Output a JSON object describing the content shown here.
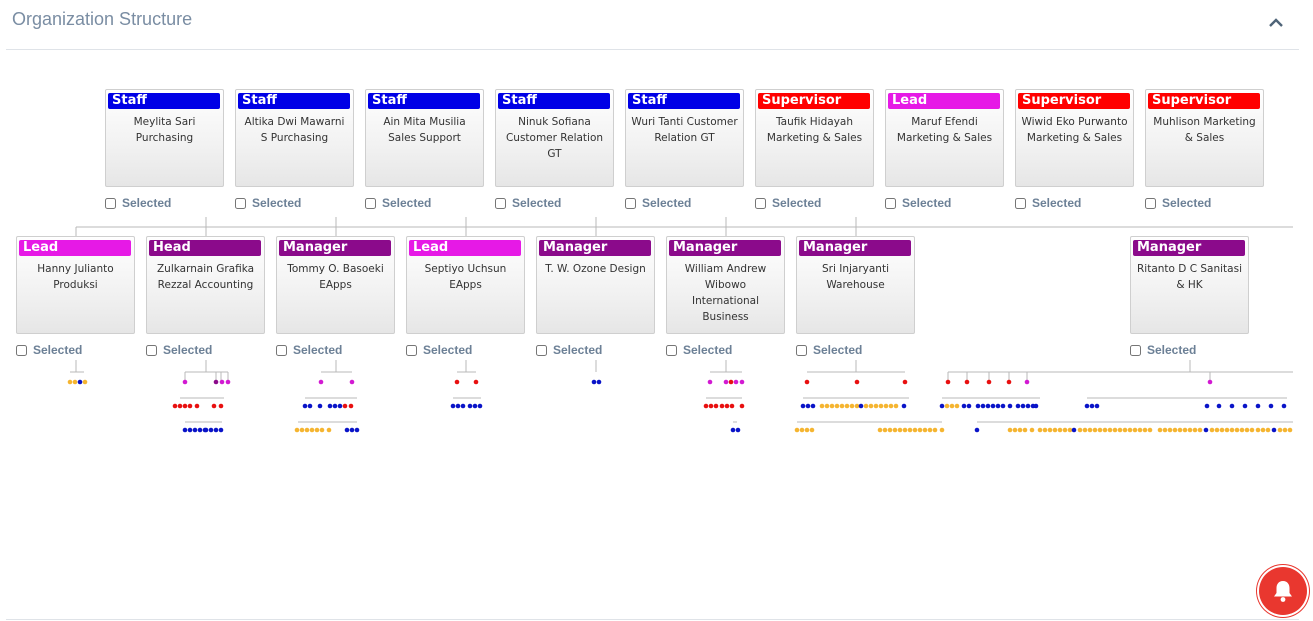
{
  "panel": {
    "title": "Organization Structure",
    "collapse_icon": "chevron-up-icon"
  },
  "colors": {
    "Staff": "#0000e6",
    "Supervisor": "#ff0000",
    "Lead": "#e619e6",
    "Head": "#8b0a8b",
    "Manager": "#8b0a8b"
  },
  "selected_label": "Selected",
  "row1": [
    {
      "role": "Staff",
      "name": "Meylita Sari Purchasing"
    },
    {
      "role": "Staff",
      "name": "Altika Dwi Mawarni S Purchasing"
    },
    {
      "role": "Staff",
      "name": "Ain Mita Musilia Sales Support"
    },
    {
      "role": "Staff",
      "name": "Ninuk Sofiana Customer Relation GT"
    },
    {
      "role": "Staff",
      "name": "Wuri Tanti Customer Relation GT"
    },
    {
      "role": "Supervisor",
      "name": "Taufik Hidayah Marketing & Sales"
    },
    {
      "role": "Lead",
      "name": "Maruf Efendi Marketing & Sales"
    },
    {
      "role": "Supervisor",
      "name": "Wiwid Eko Purwanto Marketing & Sales"
    },
    {
      "role": "Supervisor",
      "name": "Muhlison Marketing & Sales"
    }
  ],
  "row2": [
    {
      "role": "Lead",
      "name": "Hanny Julianto Produksi"
    },
    {
      "role": "Head",
      "name": "Zulkarnain Grafika Rezzal Accounting"
    },
    {
      "role": "Manager",
      "name": "Tommy O. Basoeki EApps"
    },
    {
      "role": "Lead",
      "name": "Septiyo Uchsun EApps"
    },
    {
      "role": "Manager",
      "name": "T. W. Ozone Design"
    },
    {
      "role": "Manager",
      "name": "William Andrew Wibowo International Business"
    },
    {
      "role": "Manager",
      "name": "Sri Injaryanti Warehouse"
    },
    {
      "role": "Manager",
      "name": "Ritanto D C Sanitasi & HK"
    }
  ],
  "notification": {
    "icon": "bell-icon"
  }
}
